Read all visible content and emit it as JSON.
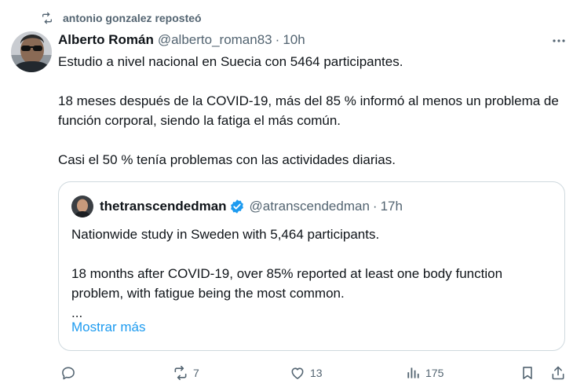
{
  "repost": {
    "text": "antonio gonzalez reposteó"
  },
  "tweet": {
    "author_name": "Alberto Román",
    "handle": "@alberto_roman83",
    "separator": "·",
    "time": "10h",
    "paragraphs": [
      "Estudio a nivel nacional en Suecia con 5464 participantes.",
      "18 meses después de la COVID-19, más del 85 % informó al menos un problema de función corporal, siendo la fatiga el más común.",
      "Casi el 50 % tenía problemas con las actividades diarias."
    ]
  },
  "quote": {
    "author_name": "thetranscendedman",
    "handle": "@atranscendedman",
    "separator": "·",
    "time": "17h",
    "paragraphs": [
      "Nationwide study in Sweden with 5,464 participants.",
      "18 months after COVID-19, over 85% reported at least one body function problem, with fatigue being the most common.\n..."
    ],
    "show_more": "Mostrar más"
  },
  "actions": {
    "replies": "",
    "reposts": "7",
    "likes": "13",
    "views": "175"
  },
  "icons": {
    "repost": "repost-icon",
    "more": "more-icon",
    "verified": "verified-badge-icon",
    "reply": "reply-icon",
    "like": "heart-icon",
    "views": "views-icon",
    "bookmark": "bookmark-icon",
    "share": "share-icon"
  },
  "colors": {
    "text": "#0f1419",
    "muted": "#536471",
    "accent": "#1d9bf0",
    "border": "#cfd9de"
  }
}
